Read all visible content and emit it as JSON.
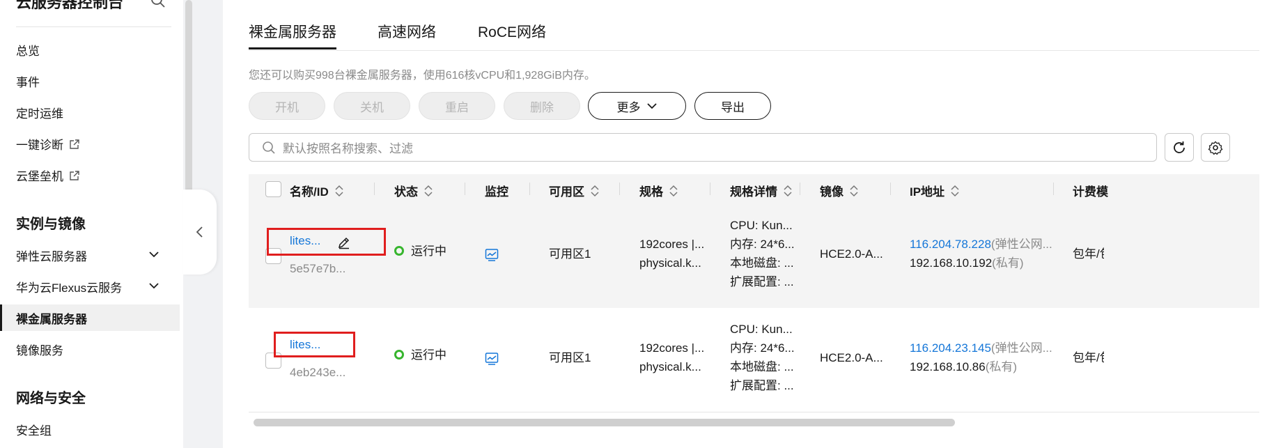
{
  "sidebar": {
    "title": "云服务器控制台",
    "items": [
      {
        "label": "总览"
      },
      {
        "label": "事件"
      },
      {
        "label": "定时运维"
      },
      {
        "label": "一键诊断"
      },
      {
        "label": "云堡垒机"
      }
    ],
    "sections": [
      {
        "label": "实例与镜像"
      },
      {
        "label": "网络与安全"
      }
    ],
    "instance_items": [
      {
        "label": "弹性云服务器"
      },
      {
        "label": "华为云Flexus云服务"
      },
      {
        "label": "裸金属服务器"
      },
      {
        "label": "镜像服务"
      }
    ],
    "network_items": [
      {
        "label": "安全组"
      }
    ]
  },
  "tabs": [
    {
      "label": "裸金属服务器"
    },
    {
      "label": "高速网络"
    },
    {
      "label": "RoCE网络"
    }
  ],
  "quota_text": "您还可以购买998台裸金属服务器，使用616核vCPU和1,928GiB内存。",
  "toolbar": {
    "start": "开机",
    "stop": "关机",
    "restart": "重启",
    "delete": "删除",
    "more": "更多",
    "export": "导出"
  },
  "search": {
    "placeholder": "默认按照名称搜索、过滤"
  },
  "table": {
    "headers": {
      "name": "名称/ID",
      "status": "状态",
      "monitor": "监控",
      "az": "可用区",
      "spec": "规格",
      "spec_detail": "规格详情",
      "image": "镜像",
      "ip": "IP地址",
      "billing": "计费模"
    },
    "rows": [
      {
        "name": "lites...",
        "id": "5e57e7b...",
        "status": "运行中",
        "az": "可用区1",
        "spec_line1": "192cores |...",
        "spec_line2": "physical.k...",
        "detail_cpu": "CPU: Kun...",
        "detail_mem": "内存: 24*6...",
        "detail_disk": "本地磁盘: ...",
        "detail_ext": "扩展配置: ...",
        "image": "HCE2.0-A...",
        "ip_public": "116.204.78.228",
        "ip_public_suffix": "(弹性公网...",
        "ip_private": "192.168.10.192",
        "ip_private_suffix": "(私有)",
        "billing": "包年/包"
      },
      {
        "name": "lites...",
        "id": "4eb243e...",
        "status": "运行中",
        "az": "可用区1",
        "spec_line1": "192cores |...",
        "spec_line2": "physical.k...",
        "detail_cpu": "CPU: Kun...",
        "detail_mem": "内存: 24*6...",
        "detail_disk": "本地磁盘: ...",
        "detail_ext": "扩展配置: ...",
        "image": "HCE2.0-A...",
        "ip_public": "116.204.23.145",
        "ip_public_suffix": "(弹性公网...",
        "ip_private": "192.168.10.86",
        "ip_private_suffix": "(私有)",
        "billing": "包年/包"
      }
    ]
  },
  "colors": {
    "link": "#1476d8",
    "running": "#37b52e",
    "highlight_box": "#e01e1e"
  }
}
